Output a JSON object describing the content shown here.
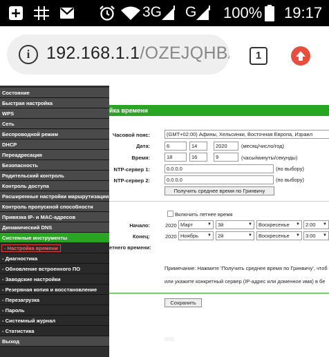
{
  "status_bar": {
    "battery_percent": "100%",
    "clock": "19:17",
    "network_3g": "3G",
    "network_g": "G",
    "icons": [
      "add-box-icon",
      "grid-icon",
      "mail-icon",
      "alarm-icon",
      "wifi-icon",
      "signal-icon",
      "signal-icon",
      "battery-icon"
    ]
  },
  "browser": {
    "url_host": "192.168.1.1",
    "url_path": "/OZEJQHBA",
    "tab_count": "1",
    "info_icon_glyph": "i",
    "update_color": "#e84e3d"
  },
  "sidebar": {
    "items": [
      {
        "label": "Состояние"
      },
      {
        "label": "Быстрая настройка"
      },
      {
        "label": "WPS"
      },
      {
        "label": "Сеть"
      },
      {
        "label": "Беспроводной режим"
      },
      {
        "label": "DHCP"
      },
      {
        "label": "Переадресация"
      },
      {
        "label": "Безопасность"
      },
      {
        "label": "Родительский контроль"
      },
      {
        "label": "Контроль доступа"
      },
      {
        "label": "Расширенные настройки маршрутизации"
      },
      {
        "label": "Контроль пропускной способности"
      },
      {
        "label": "Привязка IP- и MAC-адресов"
      },
      {
        "label": "Динамический DNS"
      },
      {
        "label": "Системные инструменты"
      },
      {
        "label": "- Настройка времени"
      },
      {
        "label": "- Диагностика"
      },
      {
        "label": "- Обновление встроенного ПО"
      },
      {
        "label": "- Заводские настройки"
      },
      {
        "label": "- Резервная копия и восстановление"
      },
      {
        "label": "- Перезагрузка"
      },
      {
        "label": "- Пароль"
      },
      {
        "label": "- Системный журнал"
      },
      {
        "label": "- Статистика"
      },
      {
        "label": "Выход"
      }
    ],
    "active_color": "#2aa523"
  },
  "form": {
    "title": "йка времени",
    "timezone_label": "Часовой пояс:",
    "timezone_value": "(GMT+02:00) Афины, Хельсинки, Восточная Европа, Израил",
    "date_label": "Дата:",
    "date_month": "6",
    "date_day": "14",
    "date_year": "2020",
    "date_hint": "(месяц/число/год)",
    "time_label": "Время:",
    "time_h": "18",
    "time_m": "16",
    "time_s": "9",
    "time_hint": "(часы/минуты/секунды)",
    "ntp1_label": "NTP-сервер 1:",
    "ntp1_value": "0.0.0.0",
    "ntp1_hint": "(по выбору)",
    "ntp2_label": "NTP-сервер 2:",
    "ntp2_value": "0.0.0.0",
    "ntp2_hint": "(по выбору)",
    "gmt_button": "Получить среднее время по Гринвичу",
    "dst_checkbox_label": "Включить летнее время",
    "start_label": "Начало:",
    "start_year": "2020",
    "start_month": "Март",
    "start_week": "3й",
    "start_day": "Воскресенье",
    "start_time": "2:00",
    "end_label": "Конец:",
    "end_year": "2020",
    "end_month": "Ноябрь",
    "end_week": "2й",
    "end_day": "Воскресенье",
    "end_time": "3:00",
    "dst_status_label": "етнего времени:",
    "note_line1": "Примечание: Нажмите 'Получить среднее время по Гринвичу', чтоб",
    "note_line2": "или укажите конкретный сервер (IP-адрес или доменное имя) в бе",
    "save_button": "Сохранить"
  }
}
